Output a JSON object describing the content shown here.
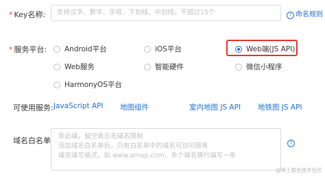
{
  "key_name": {
    "label": "Key名称:",
    "placeholder": "支持汉字、数字、字母、下划线、中划线，不超过15个",
    "help_link": "命名规则"
  },
  "service_platform": {
    "label": "服务平台:",
    "options": [
      {
        "label": "Android平台",
        "selected": false
      },
      {
        "label": "iOS平台",
        "selected": false
      },
      {
        "label": "Web端(JS API)",
        "selected": true
      },
      {
        "label": "Web服务",
        "selected": false
      },
      {
        "label": "智能硬件",
        "selected": false
      },
      {
        "label": "微信小程序",
        "selected": false
      },
      {
        "label": "HarmonyOS平台",
        "selected": false
      }
    ]
  },
  "available_services": {
    "label": "可使用服务:",
    "links": [
      "JavaScript API",
      "地图组件",
      "室内地图 JS API",
      "地铁图 JS API"
    ]
  },
  "domain_whitelist": {
    "label": "域名白名单:",
    "placeholder_lines": [
      "非必填，留空表示无域名限制",
      "添加域名白名单后，只有白名单中的域名可访问服务",
      "域名填写格式，如 www.amap.com，多个域名换行填写一条"
    ]
  },
  "watermark": "@稀土掘金技术社区",
  "colors": {
    "accent": "#1f6ed4",
    "highlight": "#e2332a",
    "required": "#e0453b"
  }
}
